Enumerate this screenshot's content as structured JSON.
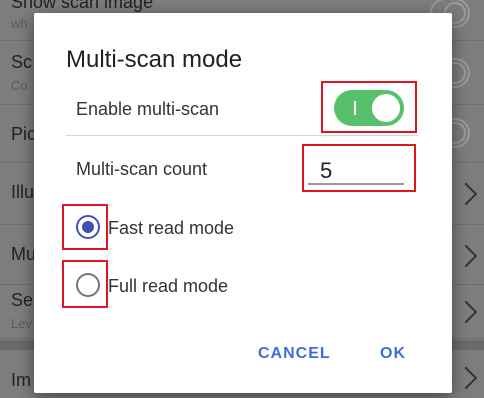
{
  "background_list": {
    "rows": [
      {
        "title": "Show scan image",
        "sub": "wh",
        "control": "toggle"
      },
      {
        "title": "Sc",
        "sub": "Co",
        "control": "toggle"
      },
      {
        "title": "Pic",
        "sub": "",
        "control": "toggle"
      },
      {
        "title": "Illu",
        "sub": "",
        "control": "chevron"
      },
      {
        "title": "Mu",
        "sub": "",
        "control": "chevron"
      },
      {
        "title": "Se",
        "sub": "Lev",
        "control": "chevron"
      },
      {
        "title": "Im",
        "sub": "",
        "control": "chevron"
      }
    ]
  },
  "dialog": {
    "title": "Multi-scan mode",
    "enable_label": "Enable multi-scan",
    "enable_state": true,
    "count_label": "Multi-scan count",
    "count_value": "5",
    "options": [
      {
        "label": "Fast read mode",
        "selected": true
      },
      {
        "label": "Full read mode",
        "selected": false
      }
    ],
    "cancel_label": "CANCEL",
    "ok_label": "OK"
  },
  "colors": {
    "switch_on": "#58bf6a",
    "radio_accent": "#3f51b5",
    "button_text": "#3f6fd6",
    "highlight_box": "#e0141e"
  },
  "icons": {
    "switch": "toggle-switch-icon",
    "chevron": "chevron-right-icon"
  }
}
